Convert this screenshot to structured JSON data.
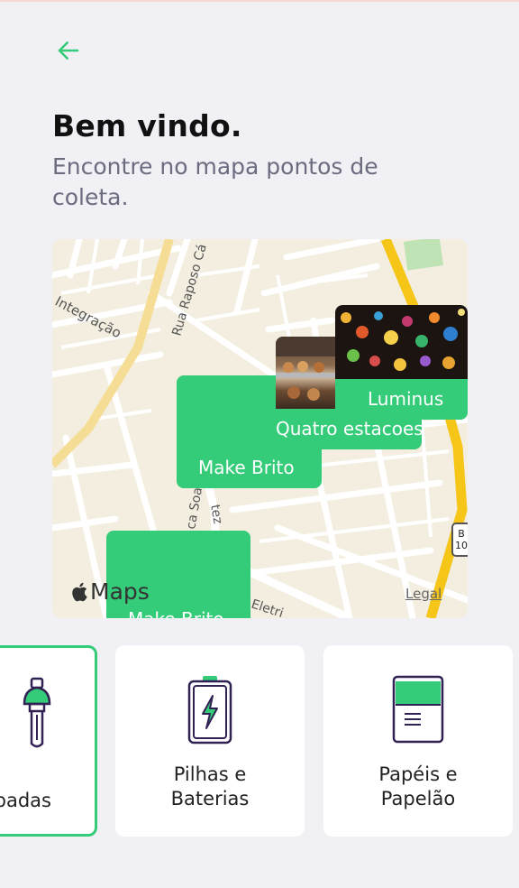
{
  "header": {
    "back_icon": "arrow-left-icon",
    "title": "Bem vindo.",
    "subtitle": "Encontre no mapa pontos de coleta."
  },
  "colors": {
    "accent": "#34cb79",
    "title": "#111111",
    "subtitle": "#6c6c80",
    "background": "#f0f0f5"
  },
  "map": {
    "street_labels": {
      "integracao": "Integração",
      "raposo": "Rua Raposo Cá",
      "soa": "ca Soa",
      "tez": "tez",
      "eletri": "Eletri"
    },
    "route_shield": "B\n10",
    "brand": "Maps",
    "legal": "Legal",
    "points": [
      {
        "name": "Luminus"
      },
      {
        "name": "Quatro estacoes"
      },
      {
        "name": "Make Brito"
      },
      {
        "name": "Make Brito"
      }
    ]
  },
  "items": [
    {
      "label": "Lâmpadas",
      "visible_label": "padas",
      "icon": "lamp-icon",
      "selected": true
    },
    {
      "label": "Pilhas e\nBaterias",
      "icon": "battery-icon",
      "selected": false
    },
    {
      "label": "Papéis e\nPapelão",
      "icon": "paper-icon",
      "selected": false
    }
  ]
}
